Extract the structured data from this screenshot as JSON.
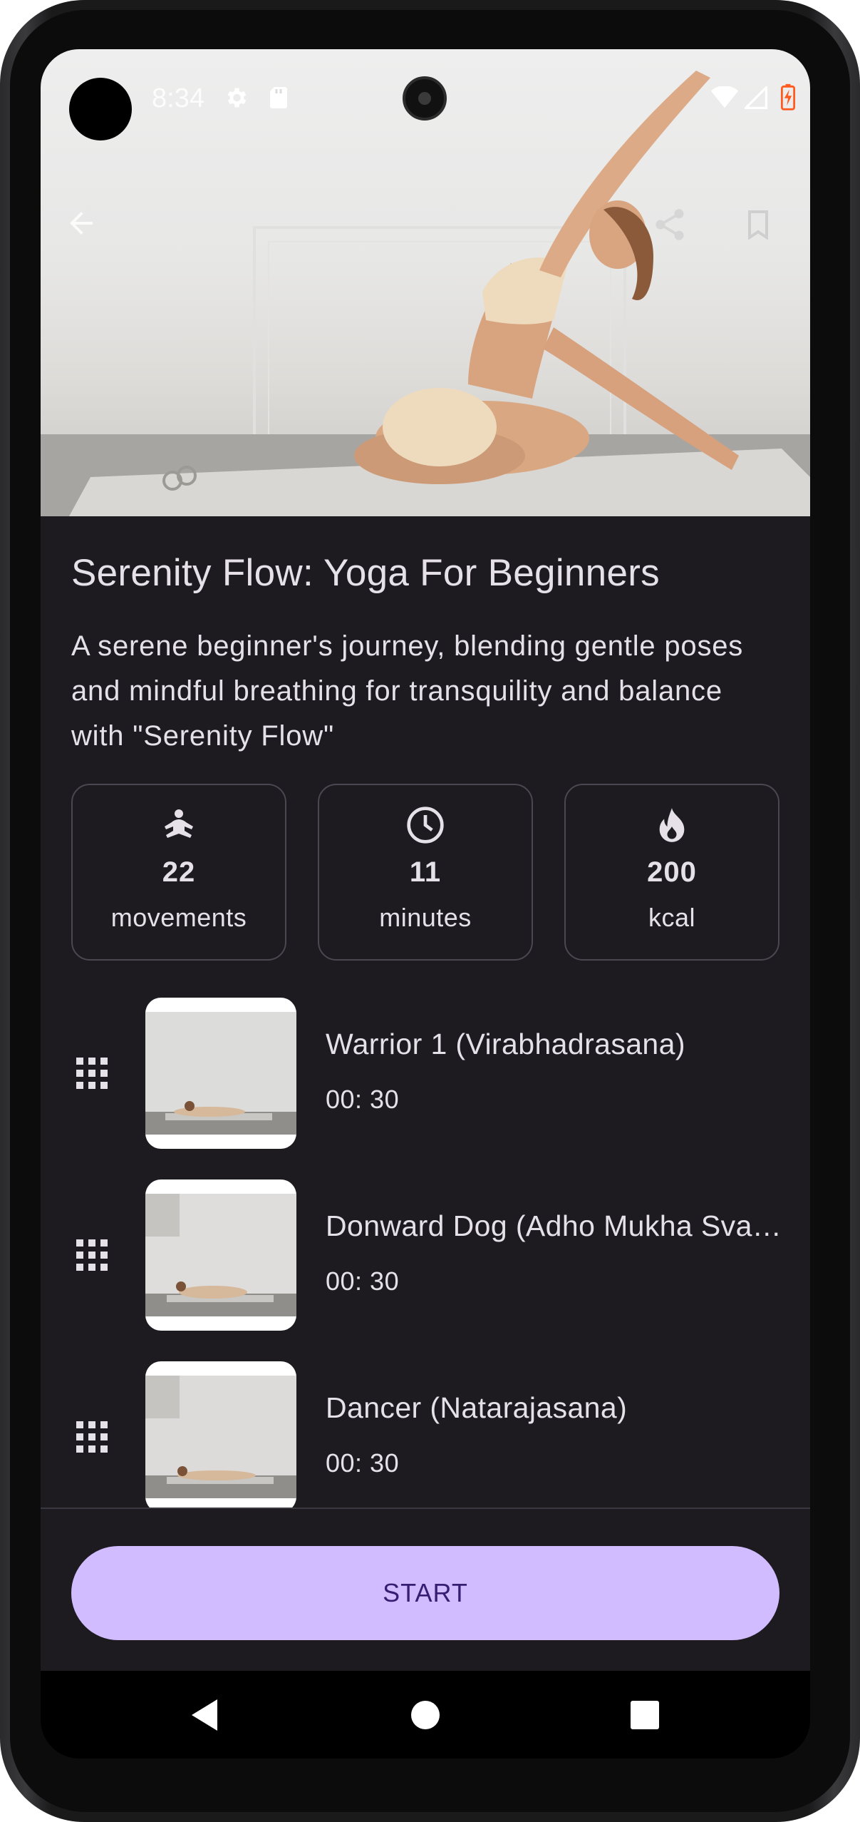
{
  "status_bar": {
    "time": "8:34",
    "icons": [
      "gear-icon",
      "sd-card-icon",
      "wifi-icon",
      "signal-icon",
      "battery-charging-icon"
    ]
  },
  "top_bar": {
    "icons": [
      "back-arrow-icon",
      "share-icon",
      "bookmark-icon"
    ]
  },
  "workout": {
    "title": "Serenity Flow: Yoga For Beginners",
    "description": "A serene beginner's journey, blending gentle poses and mindful breathing for transquility and balance with \"Serenity Flow\""
  },
  "stats": [
    {
      "icon": "meditation-icon",
      "value": "22",
      "label": "movements"
    },
    {
      "icon": "clock-icon",
      "value": "11",
      "label": "minutes"
    },
    {
      "icon": "fire-icon",
      "value": "200",
      "label": "kcal"
    }
  ],
  "exercises": [
    {
      "name": "Warrior 1 (Virabhadrasana)",
      "duration": "00: 30"
    },
    {
      "name": "Donward Dog (Adho Mukha Svanasana)",
      "duration": "00: 30"
    },
    {
      "name": "Dancer (Natarajasana)",
      "duration": "00: 30"
    }
  ],
  "start_button": {
    "label": "START"
  },
  "colors": {
    "background": "#1d1b20",
    "on_surface": "#e6e0e9",
    "primary_container": "#d0bcff",
    "on_primary_container": "#381e72",
    "outline": "#4a4850"
  },
  "nav_bar": {
    "icons": [
      "back-triangle-icon",
      "home-circle-icon",
      "recents-square-icon"
    ]
  }
}
